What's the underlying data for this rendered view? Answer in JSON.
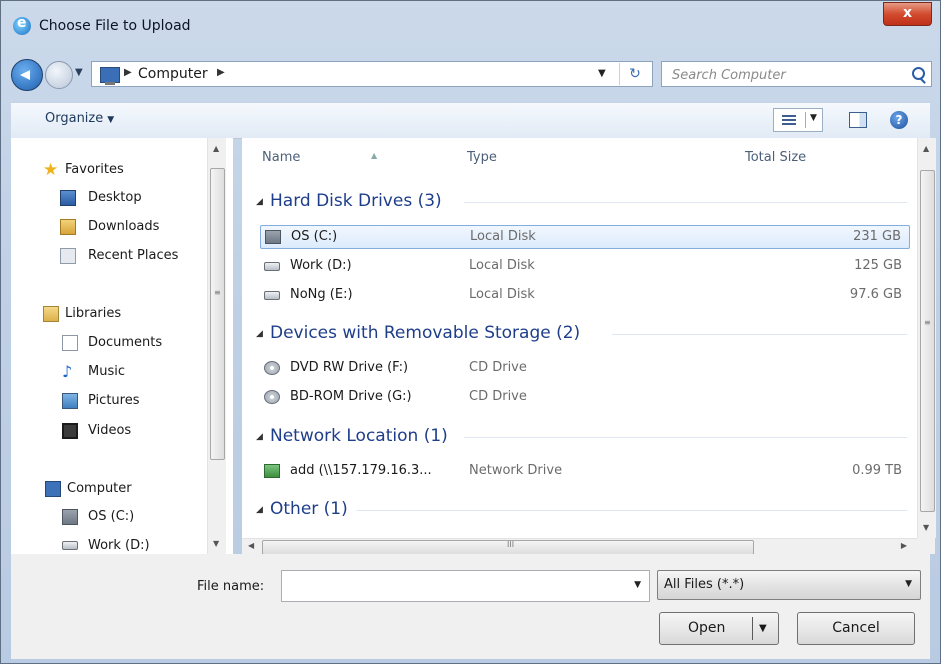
{
  "window": {
    "title": "Choose File to Upload",
    "close_glyph": "x"
  },
  "nav": {
    "address_segments": [
      "Computer"
    ],
    "search_placeholder": "Search Computer",
    "refresh_glyph": "↻"
  },
  "toolbar": {
    "organize_label": "Organize",
    "help_glyph": "?"
  },
  "sidebar": {
    "favorites": {
      "label": "Favorites",
      "items": [
        {
          "label": "Desktop",
          "icon": "desktop-icon"
        },
        {
          "label": "Downloads",
          "icon": "downloads-icon"
        },
        {
          "label": "Recent Places",
          "icon": "recent-places-icon"
        }
      ]
    },
    "libraries": {
      "label": "Libraries",
      "items": [
        {
          "label": "Documents",
          "icon": "documents-icon"
        },
        {
          "label": "Music",
          "icon": "music-icon"
        },
        {
          "label": "Pictures",
          "icon": "pictures-icon"
        },
        {
          "label": "Videos",
          "icon": "videos-icon"
        }
      ]
    },
    "computer": {
      "label": "Computer",
      "items": [
        {
          "label": "OS (C:)",
          "icon": "os-drive-icon"
        },
        {
          "label": "Work (D:)",
          "icon": "hard-drive-icon"
        }
      ]
    }
  },
  "columns": {
    "name": "Name",
    "type": "Type",
    "total_size": "Total Size"
  },
  "groups": [
    {
      "title": "Hard Disk Drives (3)",
      "rows": [
        {
          "name": "OS (C:)",
          "type": "Local Disk",
          "size": "231 GB",
          "icon": "os-drive-icon",
          "selected": true
        },
        {
          "name": "Work (D:)",
          "type": "Local Disk",
          "size": "125 GB",
          "icon": "hard-drive-icon"
        },
        {
          "name": "NoNg (E:)",
          "type": "Local Disk",
          "size": "97.6 GB",
          "icon": "hard-drive-icon"
        }
      ]
    },
    {
      "title": "Devices with Removable Storage (2)",
      "rows": [
        {
          "name": "DVD RW Drive (F:)",
          "type": "CD Drive",
          "size": "",
          "icon": "cd-drive-icon"
        },
        {
          "name": "BD-ROM Drive (G:)",
          "type": "CD Drive",
          "size": "",
          "icon": "cd-drive-icon"
        }
      ]
    },
    {
      "title": "Network Location (1)",
      "rows": [
        {
          "name": "add (\\\\157.179.16.3...",
          "type": "Network Drive",
          "size": "0.99 TB",
          "icon": "network-drive-icon"
        }
      ]
    },
    {
      "title": "Other (1)",
      "rows": []
    }
  ],
  "bottom": {
    "file_name_label": "File name:",
    "file_name_value": "",
    "filter_label": "All Files (*.*)",
    "open_label": "Open",
    "cancel_label": "Cancel"
  }
}
